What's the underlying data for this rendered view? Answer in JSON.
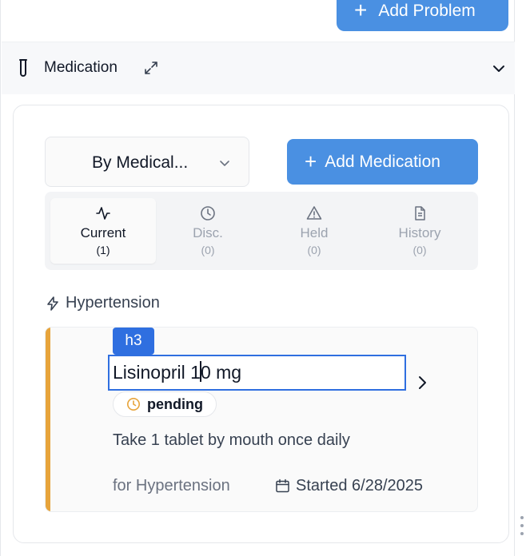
{
  "header": {
    "add_problem_label": "Add Problem"
  },
  "section": {
    "title": "Medication",
    "icon": "test-tube-icon"
  },
  "toolbar": {
    "group_by_value": "By Medical...",
    "add_medication_label": "Add Medication"
  },
  "tabs": [
    {
      "label": "Current",
      "count": "(1)",
      "icon": "activity-icon",
      "active": true
    },
    {
      "label": "Disc.",
      "count": "(0)",
      "icon": "clock-icon",
      "active": false
    },
    {
      "label": "Held",
      "count": "(0)",
      "icon": "warning-icon",
      "active": false
    },
    {
      "label": "History",
      "count": "(0)",
      "icon": "document-icon",
      "active": false
    }
  ],
  "condition": {
    "name": "Hypertension"
  },
  "medication": {
    "editor_tag": "h3",
    "name_before_caret": "Lisinopril 1",
    "name_after_caret": "0 mg",
    "status": "pending",
    "sig": "Take 1 tablet by mouth once daily",
    "indication": "for Hypertension",
    "started": "Started 6/28/2025"
  },
  "colors": {
    "accent_blue": "#4a90e2",
    "editor_blue": "#2f6fe0",
    "pending_orange": "#e7a43b"
  }
}
